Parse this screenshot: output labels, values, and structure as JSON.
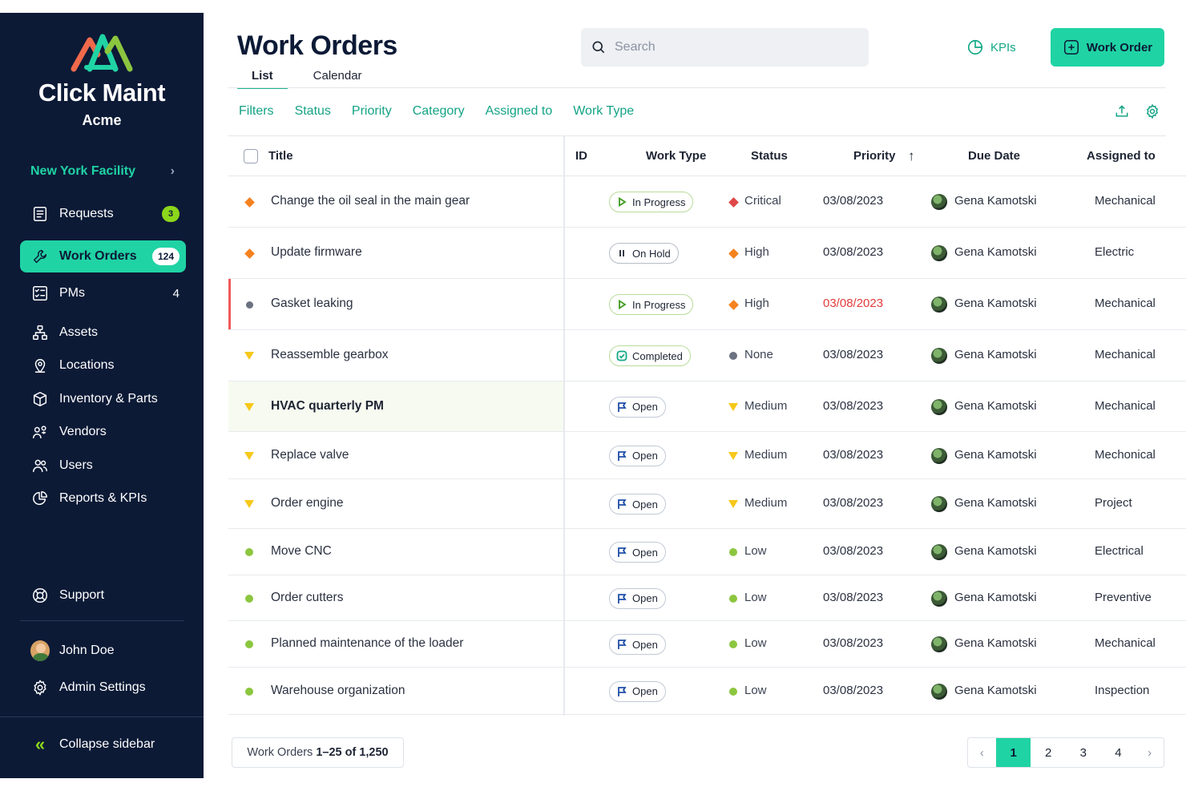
{
  "brand": {
    "name": "Click Maint",
    "org": "Acme"
  },
  "facility": "New York Facility",
  "nav": {
    "requests": {
      "label": "Requests",
      "count": "3"
    },
    "work_orders": {
      "label": "Work Orders",
      "count": "124"
    },
    "pms": {
      "label": "PMs",
      "count": "4"
    },
    "assets": "Assets",
    "locations": "Locations",
    "inventory": "Inventory & Parts",
    "vendors": "Vendors",
    "users": "Users",
    "reports": "Reports & KPIs",
    "support": "Support",
    "user_name": "John Doe",
    "admin": "Admin Settings",
    "collapse": "Collapse sidebar"
  },
  "header": {
    "title": "Work Orders",
    "tabs": [
      "List",
      "Calendar"
    ],
    "search_placeholder": "Search",
    "kpis": "KPIs",
    "new_button": "Work Order"
  },
  "filters": [
    "Filters",
    "Status",
    "Priority",
    "Category",
    "Assigned to",
    "Work Type"
  ],
  "columns": {
    "title": "Title",
    "id": "ID",
    "work_type": "Work Type",
    "status": "Status",
    "priority": "Priority",
    "due": "Due Date",
    "assigned": "Assigned to"
  },
  "rows": [
    {
      "title": "Change the oil seal in the main gear",
      "wo_status": "In Progress",
      "priority": "Critical",
      "due": "03/08/2023",
      "assigned": "Gena Kamotski",
      "category": "Mechanical"
    },
    {
      "title": "Update firmware",
      "wo_status": "On Hold",
      "priority": "High",
      "due": "03/08/2023",
      "assigned": "Gena Kamotski",
      "category": "Electric"
    },
    {
      "title": "Gasket leaking",
      "wo_status": "In Progress",
      "priority": "High",
      "due": "03/08/2023",
      "assigned": "Gena Kamotski",
      "category": "Mechanical"
    },
    {
      "title": "Reassemble gearbox",
      "wo_status": "Completed",
      "priority": "None",
      "due": "03/08/2023",
      "assigned": "Gena Kamotski",
      "category": "Mechanical"
    },
    {
      "title": "HVAC quarterly PM",
      "wo_status": "Open",
      "priority": "Medium",
      "due": "03/08/2023",
      "assigned": "Gena Kamotski",
      "category": "Mechanical"
    },
    {
      "title": "Replace valve",
      "wo_status": "Open",
      "priority": "Medium",
      "due": "03/08/2023",
      "assigned": "Gena Kamotski",
      "category": "Mechonical"
    },
    {
      "title": "Order engine",
      "wo_status": "Open",
      "priority": "Medium",
      "due": "03/08/2023",
      "assigned": "Gena Kamotski",
      "category": "Project"
    },
    {
      "title": "Move CNC",
      "wo_status": "Open",
      "priority": "Low",
      "due": "03/08/2023",
      "assigned": "Gena Kamotski",
      "category": "Electrical"
    },
    {
      "title": "Order cutters",
      "wo_status": "Open",
      "priority": "Low",
      "due": "03/08/2023",
      "assigned": "Gena Kamotski",
      "category": "Preventive"
    },
    {
      "title": "Planned maintenance of the loader",
      "wo_status": "Open",
      "priority": "Low",
      "due": "03/08/2023",
      "assigned": "Gena Kamotski",
      "category": "Mechanical"
    },
    {
      "title": "Warehouse organization",
      "wo_status": "Open",
      "priority": "Low",
      "due": "03/08/2023",
      "assigned": "Gena Kamotski",
      "category": "Inspection"
    }
  ],
  "footer": {
    "summary_prefix": "Work Orders",
    "summary_range": "1–25 of 1,250",
    "pages": [
      "1",
      "2",
      "3",
      "4"
    ],
    "current_page": "1"
  },
  "colors": {
    "sidebar_bg": "#0c1a36",
    "accent": "#20d3a4",
    "link": "#14a385",
    "critical": "#e04848",
    "high": "#f5821f",
    "medium": "#f6c81a",
    "low": "#8cc63f",
    "none": "#6c7280",
    "overdue": "#e23b3b"
  },
  "icons": {
    "priority": {
      "Critical": "diamond",
      "High": "diamond",
      "Medium": "triangle",
      "Low": "dot",
      "None": "dot"
    },
    "status": {
      "In Progress": "play-icon",
      "On Hold": "pause-icon",
      "Completed": "check-icon",
      "Open": "flag-icon"
    }
  }
}
